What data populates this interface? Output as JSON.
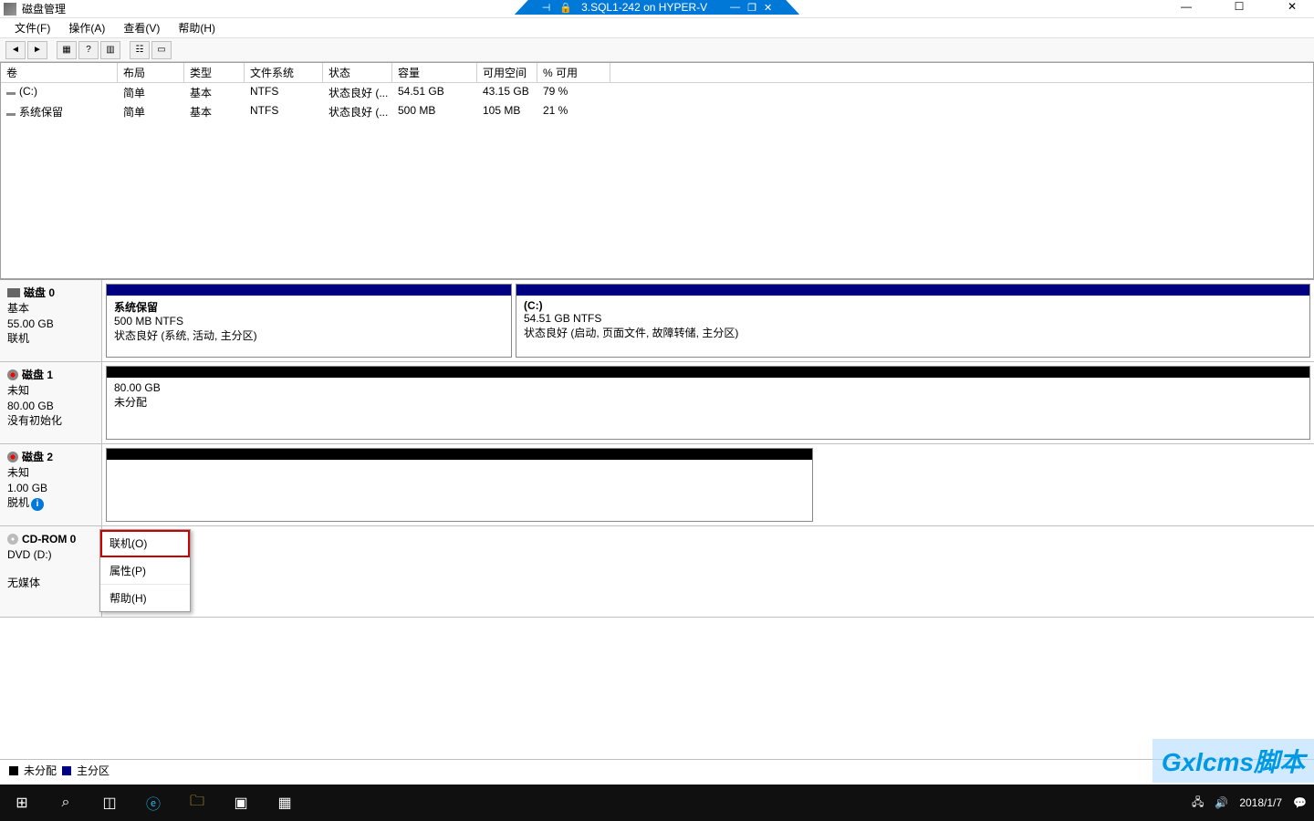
{
  "window": {
    "title": "磁盘管理",
    "vm_title": "3.SQL1-242 on HYPER-V"
  },
  "menu": {
    "file": "文件(F)",
    "action": "操作(A)",
    "view": "查看(V)",
    "help": "帮助(H)"
  },
  "columns": {
    "volume": "卷",
    "layout": "布局",
    "type": "类型",
    "fs": "文件系统",
    "status": "状态",
    "capacity": "容量",
    "free": "可用空间",
    "pct": "% 可用"
  },
  "volumes": [
    {
      "name": "(C:)",
      "layout": "简单",
      "type": "基本",
      "fs": "NTFS",
      "status": "状态良好 (...",
      "capacity": "54.51 GB",
      "free": "43.15 GB",
      "pct": "79 %"
    },
    {
      "name": "系统保留",
      "layout": "简单",
      "type": "基本",
      "fs": "NTFS",
      "status": "状态良好 (...",
      "capacity": "500 MB",
      "free": "105 MB",
      "pct": "21 %"
    }
  ],
  "disks": {
    "d0": {
      "title": "磁盘 0",
      "type": "基本",
      "size": "55.00 GB",
      "state": "联机",
      "p0": {
        "name": "系统保留",
        "size": "500 MB NTFS",
        "status": "状态良好 (系统, 活动, 主分区)"
      },
      "p1": {
        "name": "(C:)",
        "size": "54.51 GB NTFS",
        "status": "状态良好 (启动, 页面文件, 故障转储, 主分区)"
      }
    },
    "d1": {
      "title": "磁盘 1",
      "type": "未知",
      "size": "80.00 GB",
      "state": "没有初始化",
      "p0": {
        "size": "80.00 GB",
        "status": "未分配"
      }
    },
    "d2": {
      "title": "磁盘 2",
      "type": "未知",
      "size": "1.00 GB",
      "state": "脱机"
    },
    "cd": {
      "title": "CD-ROM 0",
      "type": "DVD (D:)",
      "state": "无媒体"
    }
  },
  "context": {
    "online": "联机(O)",
    "props": "属性(P)",
    "help": "帮助(H)"
  },
  "legend": {
    "unalloc": "未分配",
    "primary": "主分区"
  },
  "tray": {
    "date": "2018/1/7"
  },
  "watermark": "Gxlcms脚本"
}
